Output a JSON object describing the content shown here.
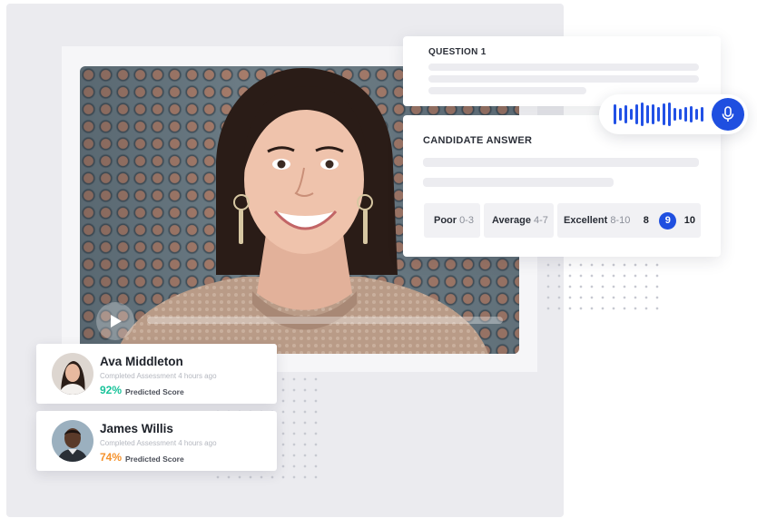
{
  "question": {
    "title": "QUESTION 1"
  },
  "answer": {
    "title": "CANDIDATE ANSWER",
    "ratings": [
      {
        "label": "Poor",
        "range": "0-3"
      },
      {
        "label": "Average",
        "range": "4-7"
      },
      {
        "label": "Excellent",
        "range": "8-10"
      }
    ],
    "scores": [
      "8",
      "9",
      "10"
    ],
    "selected_score": "9"
  },
  "video": {
    "progress": 0.0
  },
  "audio": {
    "icon": "microphone-icon"
  },
  "candidates": [
    {
      "name": "Ava Middleton",
      "subtitle": "Completed Assessment 4 hours ago",
      "score": "92%",
      "score_label": "Predicted Score",
      "score_color": "#19c39a"
    },
    {
      "name": "James Willis",
      "subtitle": "Completed Assessment 4 hours ago",
      "score": "74%",
      "score_label": "Predicted Score",
      "score_color": "#f5922c"
    }
  ],
  "colors": {
    "accent": "#1f4fe0"
  }
}
